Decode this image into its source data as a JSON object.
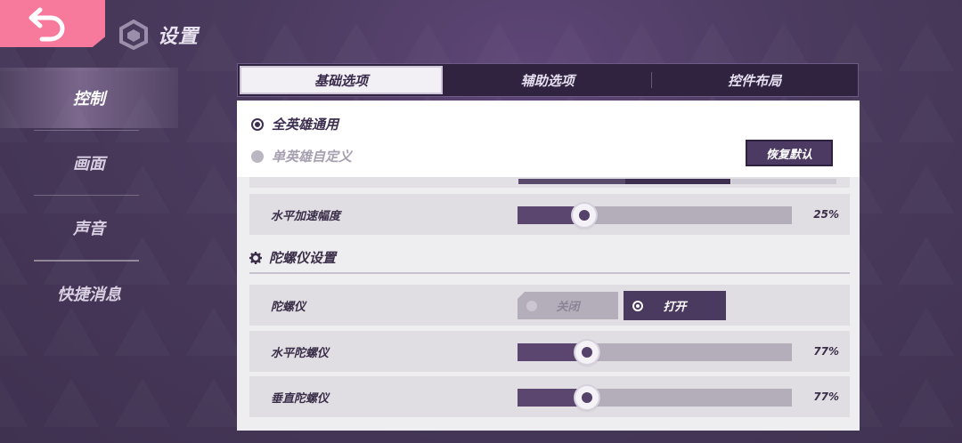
{
  "header": {
    "title": "设置"
  },
  "sidebar": {
    "items": [
      {
        "label": "控制"
      },
      {
        "label": "画面"
      },
      {
        "label": "声音"
      },
      {
        "label": "快捷消息"
      }
    ]
  },
  "tabs": [
    {
      "label": "基础选项"
    },
    {
      "label": "辅助选项"
    },
    {
      "label": "控件布局"
    }
  ],
  "hero_mode": {
    "options": [
      {
        "label": "全英雄通用",
        "selected": true
      },
      {
        "label": "单英雄自定义",
        "selected": false
      }
    ],
    "reset_label": "恢复默认"
  },
  "settings": {
    "horizontal_accel": {
      "label": "水平加速幅度",
      "value_text": "25%",
      "value": 25
    },
    "gyro_section": {
      "title": "陀螺仪设置"
    },
    "gyro": {
      "label": "陀螺仪",
      "off_label": "关闭",
      "on_label": "打开",
      "state": "on"
    },
    "horizontal_gyro": {
      "label": "水平陀螺仪",
      "value_text": "77%",
      "value": 77
    },
    "vertical_gyro": {
      "label": "垂直陀螺仪",
      "value_text": "77%",
      "value": 77
    }
  },
  "colors": {
    "accent_pink": "#f7799c",
    "primary_purple": "#4b3a5f",
    "background": "#4a3a5d"
  }
}
